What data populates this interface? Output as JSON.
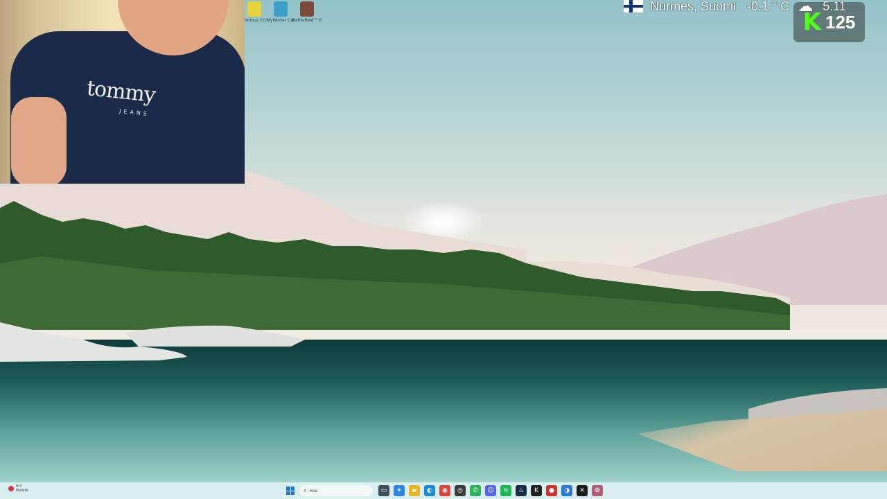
{
  "desktop": {
    "icons": [
      {
        "label": "Glorious Ccc",
        "color": "#e7d23a"
      },
      {
        "label": "MyWinter Car",
        "color": "#3aa0c8"
      },
      {
        "label": "Battlefield™ 6",
        "color": "#7a4a3a"
      }
    ]
  },
  "kick_overlay": {
    "logo": "K",
    "count": "125",
    "accent": "#53fc18"
  },
  "webcam": {
    "shirt_brand": "tommy",
    "shirt_sub": "JEANS"
  },
  "taskbar": {
    "weather_temp": "0°C",
    "weather_desc": "Pilvistä",
    "search_placeholder": "Hae",
    "apps": [
      {
        "name": "file-explorer-icon",
        "glyph": "▭",
        "color": "#3d4c5a"
      },
      {
        "name": "copilot-icon",
        "glyph": "✦",
        "color": "#2f86e0"
      },
      {
        "name": "folder-icon",
        "glyph": "▰",
        "color": "#e8b524"
      },
      {
        "name": "edge-icon",
        "glyph": "◐",
        "color": "#1b8bd6"
      },
      {
        "name": "chrome-icon",
        "glyph": "◉",
        "color": "#d9433a"
      },
      {
        "name": "obs-icon",
        "glyph": "◎",
        "color": "#3b3b3b"
      },
      {
        "name": "whatsapp-icon",
        "glyph": "✆",
        "color": "#2ab35b"
      },
      {
        "name": "discord-icon",
        "glyph": "☺",
        "color": "#5865f2"
      },
      {
        "name": "spotify-icon",
        "glyph": "≋",
        "color": "#1db954"
      },
      {
        "name": "steam-icon",
        "glyph": "♨",
        "color": "#1c2c44"
      },
      {
        "name": "kick-app-icon",
        "glyph": "K",
        "color": "#222222"
      },
      {
        "name": "record-icon",
        "glyph": "●",
        "color": "#c8322f"
      },
      {
        "name": "edge-dev-icon",
        "glyph": "◑",
        "color": "#2c78d6"
      },
      {
        "name": "capcut-icon",
        "glyph": "✕",
        "color": "#1a1a1a"
      },
      {
        "name": "tray-icon",
        "glyph": "✿",
        "color": "#b35d7a"
      }
    ]
  },
  "status": {
    "location": "Nurmes, Suomi",
    "temperature": "-0.1 ° C",
    "time": "5.11"
  }
}
